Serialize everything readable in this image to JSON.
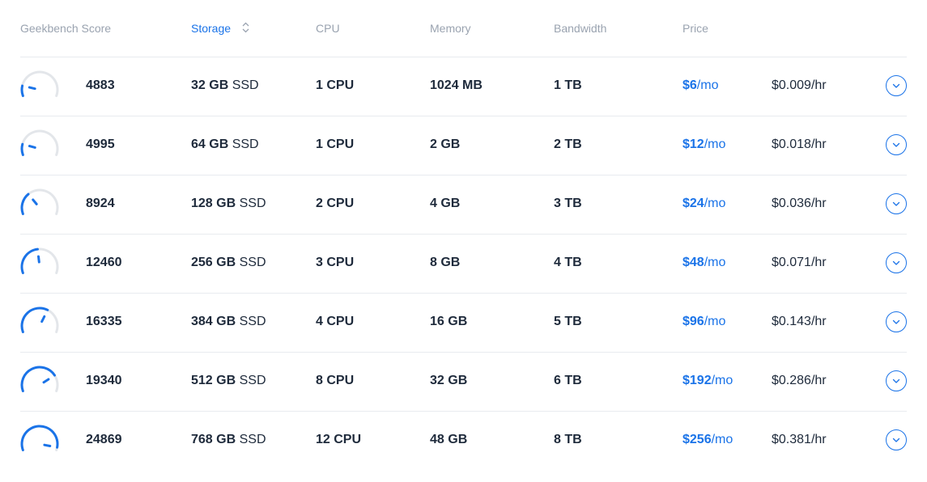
{
  "header": {
    "geekbench": "Geekbench Score",
    "storage": "Storage",
    "cpu": "CPU",
    "memory": "Memory",
    "bandwidth": "Bandwidth",
    "price": "Price",
    "sorted_column": "storage"
  },
  "colors": {
    "accent": "#1a73e8",
    "header_text": "#9aa3b0",
    "body_text": "#1e2a3b",
    "gauge_track": "#e3e6ea",
    "divider": "#e8ebef"
  },
  "icons": {
    "gauge": "speedometer-icon",
    "sort": "sort-updown-icon",
    "expand": "chevron-down-icon"
  },
  "rows": [
    {
      "score": "4883",
      "gauge_level": 0.15,
      "storage_size": "32 GB",
      "storage_type": "SSD",
      "cpu": "1 CPU",
      "memory": "1024 MB",
      "bandwidth": "1 TB",
      "price_amount": "$6",
      "price_unit": "/mo",
      "hourly": "$0.009/hr"
    },
    {
      "score": "4995",
      "gauge_level": 0.16,
      "storage_size": "64 GB",
      "storage_type": "SSD",
      "cpu": "1 CPU",
      "memory": "2 GB",
      "bandwidth": "2 TB",
      "price_amount": "$12",
      "price_unit": "/mo",
      "hourly": "$0.018/hr"
    },
    {
      "score": "8924",
      "gauge_level": 0.32,
      "storage_size": "128 GB",
      "storage_type": "SSD",
      "cpu": "2 CPU",
      "memory": "4 GB",
      "bandwidth": "3 TB",
      "price_amount": "$24",
      "price_unit": "/mo",
      "hourly": "$0.036/hr"
    },
    {
      "score": "12460",
      "gauge_level": 0.47,
      "storage_size": "256 GB",
      "storage_type": "SSD",
      "cpu": "3 CPU",
      "memory": "8 GB",
      "bandwidth": "4 TB",
      "price_amount": "$48",
      "price_unit": "/mo",
      "hourly": "$0.071/hr"
    },
    {
      "score": "16335",
      "gauge_level": 0.62,
      "storage_size": "384 GB",
      "storage_type": "SSD",
      "cpu": "4 CPU",
      "memory": "16 GB",
      "bandwidth": "5 TB",
      "price_amount": "$96",
      "price_unit": "/mo",
      "hourly": "$0.143/hr"
    },
    {
      "score": "19340",
      "gauge_level": 0.76,
      "storage_size": "512 GB",
      "storage_type": "SSD",
      "cpu": "8 CPU",
      "memory": "32 GB",
      "bandwidth": "6 TB",
      "price_amount": "$192",
      "price_unit": "/mo",
      "hourly": "$0.286/hr"
    },
    {
      "score": "24869",
      "gauge_level": 0.96,
      "storage_size": "768 GB",
      "storage_type": "SSD",
      "cpu": "12 CPU",
      "memory": "48 GB",
      "bandwidth": "8 TB",
      "price_amount": "$256",
      "price_unit": "/mo",
      "hourly": "$0.381/hr"
    }
  ]
}
